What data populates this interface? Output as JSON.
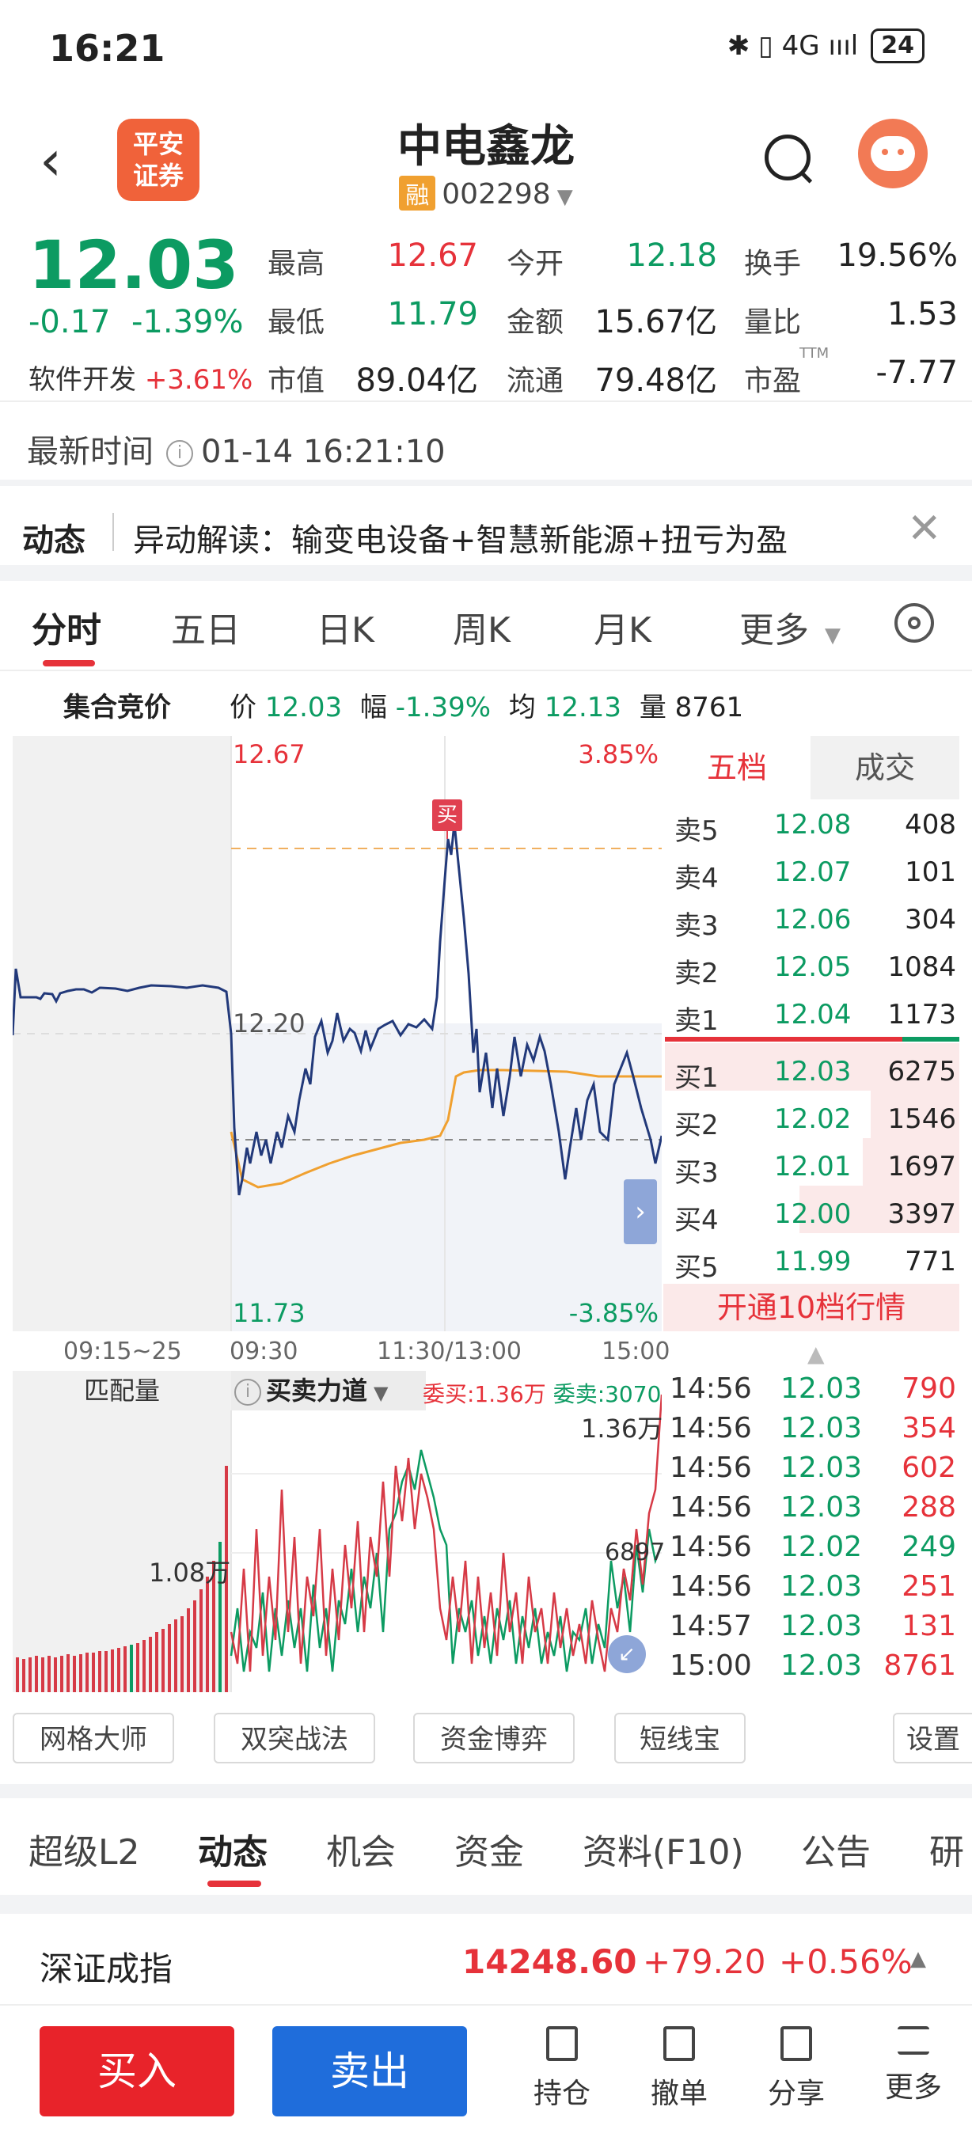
{
  "status_bar": {
    "time": "16:21",
    "icons": "✱ ▯ 4G ıııl",
    "battery": "24"
  },
  "header": {
    "title": "中电鑫龙",
    "rong_tag": "融",
    "code": "002298",
    "logo_text": [
      "平安",
      "证券"
    ]
  },
  "quote": {
    "price": "12.03",
    "change": "-0.17",
    "change_pct": "-1.39%",
    "sector_name": "软件开发",
    "sector_pct": "+3.61%",
    "stats": [
      {
        "label": "最高",
        "value": "12.67"
      },
      {
        "label": "今开",
        "value": "12.18"
      },
      {
        "label": "换手",
        "value": "19.56%"
      },
      {
        "label": "最低",
        "value": "11.79"
      },
      {
        "label": "金额",
        "value": "15.67亿"
      },
      {
        "label": "量比",
        "value": "1.53"
      },
      {
        "label": "市值",
        "value": "89.04亿"
      },
      {
        "label": "流通",
        "value": "79.48亿"
      },
      {
        "label": "市盈",
        "value": "-7.77",
        "sup": "TTM"
      }
    ]
  },
  "latest_time": {
    "label": "最新时间",
    "value": "01-14 16:21:10"
  },
  "news": {
    "label": "动态",
    "text": "异动解读：输变电设备+智慧新能源+扭亏为盈"
  },
  "chart_tabs": {
    "items": [
      "分时",
      "五日",
      "日K",
      "周K",
      "月K",
      "更多"
    ],
    "active": "分时"
  },
  "auction": {
    "label": "集合竞价",
    "price_label": "价",
    "price": "12.03",
    "range_label": "幅",
    "range": "-1.39%",
    "avg_label": "均",
    "avg": "12.13",
    "vol_label": "量",
    "vol": "8761"
  },
  "chart_labels": {
    "top_price": "12.67",
    "top_pct": "3.85%",
    "mid_price": "12.20",
    "bottom_price": "11.73",
    "bottom_pct": "-3.85%",
    "buy_marker": "买",
    "x_labels": [
      "09:15~25",
      "09:30",
      "11:30/13:00",
      "15:00"
    ]
  },
  "order_book": {
    "tabs": [
      "五档",
      "成交"
    ],
    "sells": [
      {
        "label": "卖5",
        "price": "12.08",
        "vol": "408"
      },
      {
        "label": "卖4",
        "price": "12.07",
        "vol": "101"
      },
      {
        "label": "卖3",
        "price": "12.06",
        "vol": "304"
      },
      {
        "label": "卖2",
        "price": "12.05",
        "vol": "1084"
      },
      {
        "label": "卖1",
        "price": "12.04",
        "vol": "1173"
      }
    ],
    "buys": [
      {
        "label": "买1",
        "price": "12.03",
        "vol": "6275"
      },
      {
        "label": "买2",
        "price": "12.02",
        "vol": "1546"
      },
      {
        "label": "买3",
        "price": "12.01",
        "vol": "1697"
      },
      {
        "label": "买4",
        "price": "12.00",
        "vol": "3397"
      },
      {
        "label": "买5",
        "price": "11.99",
        "vol": "771"
      }
    ],
    "upgrade": "开通10档行情"
  },
  "volume_panel": {
    "left_label": "匹配量",
    "indicator": "买卖力道",
    "wei_buy": "委买:1.36万",
    "wei_sell": "委卖:3070",
    "top_value": "1.36万",
    "left_value": "1.08万",
    "right_value": "6897"
  },
  "trades": [
    {
      "time": "14:56",
      "price": "12.03",
      "vol": "790",
      "color": "#e6323a"
    },
    {
      "time": "14:56",
      "price": "12.03",
      "vol": "354",
      "color": "#e6323a"
    },
    {
      "time": "14:56",
      "price": "12.03",
      "vol": "602",
      "color": "#e6323a"
    },
    {
      "time": "14:56",
      "price": "12.03",
      "vol": "288",
      "color": "#e6323a"
    },
    {
      "time": "14:56",
      "price": "12.02",
      "vol": "249",
      "color": "#0c9b62"
    },
    {
      "time": "14:56",
      "price": "12.03",
      "vol": "251",
      "color": "#e6323a"
    },
    {
      "time": "14:57",
      "price": "12.03",
      "vol": "131",
      "color": "#e6323a"
    },
    {
      "time": "15:00",
      "price": "12.03",
      "vol": "8761",
      "color": "#e6323a"
    }
  ],
  "tools": [
    "网格大师",
    "双突战法",
    "资金博弈",
    "短线宝",
    "设置"
  ],
  "bottom_tabs": {
    "items": [
      "超级L2",
      "动态",
      "机会",
      "资金",
      "资料(F10)",
      "公告",
      "研报"
    ],
    "active": "动态"
  },
  "index": {
    "name": "深证成指",
    "value": "14248.60",
    "change": "+79.20",
    "pct": "+0.56%"
  },
  "actions": {
    "buy": "买入",
    "sell": "卖出",
    "items": [
      "持仓",
      "撤单",
      "分享",
      "更多"
    ]
  }
}
